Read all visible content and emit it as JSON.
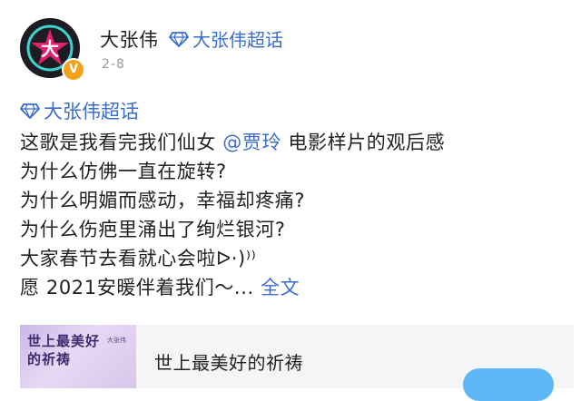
{
  "post": {
    "username": "大张伟",
    "header_topic": "大张伟超话",
    "date": "2-8",
    "verified_badge": "V",
    "topic": "大张伟超话",
    "mention": "@贾玲",
    "lines": {
      "l1_before": "这歌是我看完我们仙女",
      "l1_after": " 电影样片的观后感",
      "l2": "为什么仿佛一直在旋转?",
      "l3": "为什么明媚而感动，幸福却疼痛?",
      "l4": "为什么伤疤里涌出了绚烂银河?",
      "l5": "大家春节去看就心会啦ᐅ·)⁾⁾",
      "l6": "愿 2021安暖伴着我们～..."
    },
    "expand_label": "全文"
  },
  "card": {
    "cover_title": "世上最美好的祈祷",
    "cover_artist": "大张伟",
    "title": "世上最美好的祈祷"
  },
  "icons": {
    "topic": "diamond-icon",
    "verified": "verified-badge-icon",
    "avatar_glyph": "大"
  },
  "colors": {
    "link": "#3a6dcc",
    "text": "#222222",
    "meta": "#9a9a9a",
    "badge": "#f4a21d",
    "button": "#5fb7f5"
  }
}
